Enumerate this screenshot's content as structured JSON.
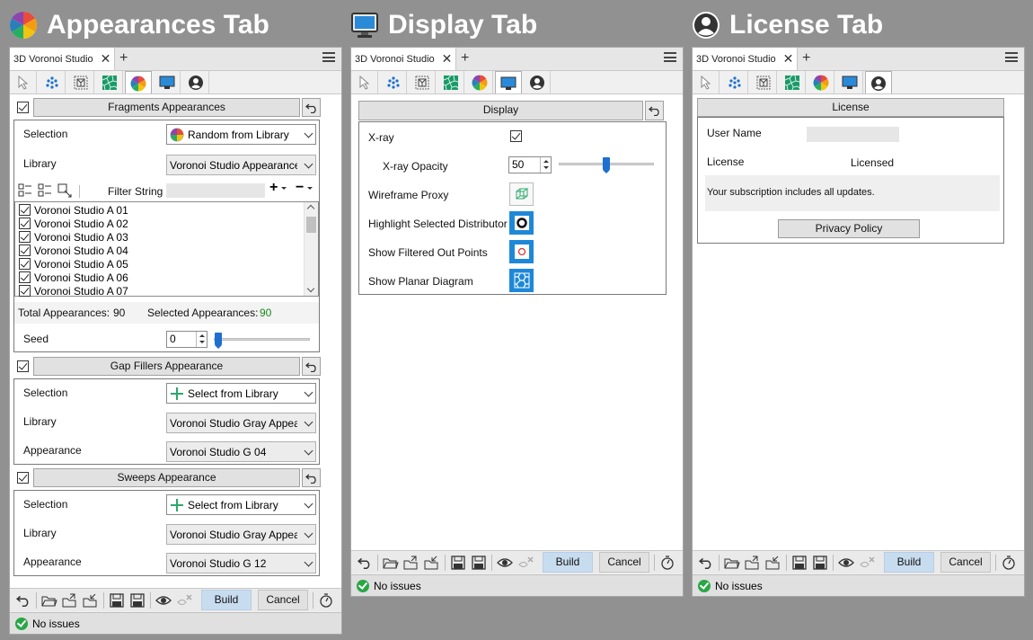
{
  "headings": {
    "appearances": "Appearances Tab",
    "display": "Display Tab",
    "license": "License Tab"
  },
  "common": {
    "doc_tab_title": "3D Voronoi Studio",
    "build_label": "Build",
    "cancel_label": "Cancel",
    "status_text": "No issues"
  },
  "appearances": {
    "fragments": {
      "header": "Fragments Appearances",
      "enabled": true,
      "selection_label": "Selection",
      "selection_value": "Random from Library",
      "library_label": "Library",
      "library_value": "Voronoi Studio Appearance Lib",
      "filter_label": "Filter String",
      "filter_value": "",
      "items": [
        "Voronoi Studio A 01",
        "Voronoi Studio A 02",
        "Voronoi Studio A 03",
        "Voronoi Studio A 04",
        "Voronoi Studio A 05",
        "Voronoi Studio A 06",
        "Voronoi Studio A 07"
      ],
      "total_label": "Total Appearances:",
      "total_value": "90",
      "selected_label": "Selected Appearances:",
      "selected_value": "90",
      "seed_label": "Seed",
      "seed_value": "0",
      "seed_slider_fraction": 0.0
    },
    "gap_fillers": {
      "header": "Gap Fillers Appearance",
      "enabled": true,
      "selection_label": "Selection",
      "selection_value": "Select from Library",
      "library_label": "Library",
      "library_value": "Voronoi Studio Gray Appearance",
      "appearance_label": "Appearance",
      "appearance_value": "Voronoi Studio G 04"
    },
    "sweeps": {
      "header": "Sweeps Appearance",
      "enabled": true,
      "selection_label": "Selection",
      "selection_value": "Select from Library",
      "library_label": "Library",
      "library_value": "Voronoi Studio Gray Appearance",
      "appearance_label": "Appearance",
      "appearance_value": "Voronoi Studio G 12"
    }
  },
  "display": {
    "header": "Display",
    "xray_label": "X-ray",
    "xray_checked": true,
    "xray_opacity_label": "X-ray Opacity",
    "xray_opacity_value": "50",
    "xray_opacity_fraction": 0.5,
    "wireframe_label": "Wireframe Proxy",
    "highlight_label": "Highlight Selected Distributor",
    "filtered_label": "Show Filtered Out Points",
    "planar_label": "Show Planar Diagram"
  },
  "license": {
    "header": "License",
    "user_name_label": "User Name",
    "user_name_value": "",
    "license_label": "License",
    "license_value": "Licensed",
    "note": "Your subscription includes all updates.",
    "privacy_button": "Privacy Policy"
  },
  "colors": {
    "accent_blue": "#1e88d8",
    "build_bg": "#c8dcf0",
    "ok_green": "#28a745",
    "selected_count_green": "#1a8a1a"
  }
}
